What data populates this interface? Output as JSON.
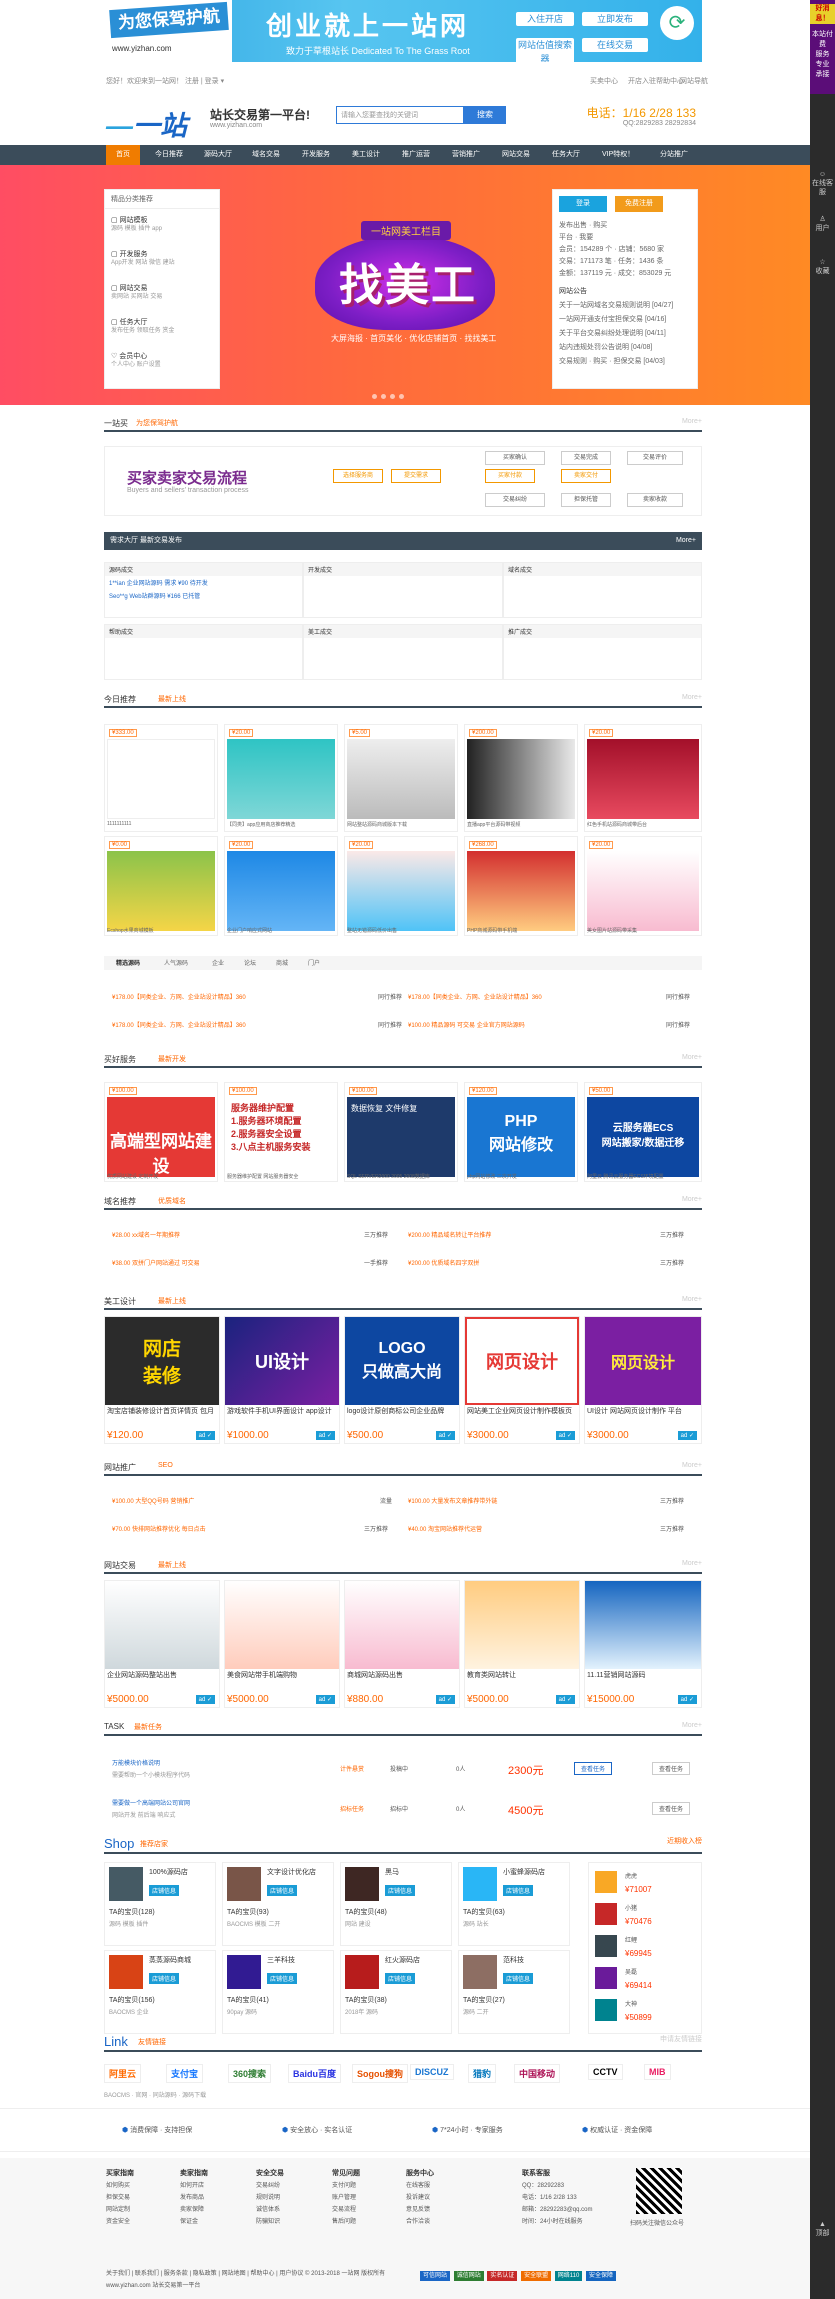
{
  "side": {
    "hot": "好消息！",
    "hot_text": [
      "本站付",
      "费",
      "服务",
      "专业",
      "承接",
      "项目"
    ],
    "icons": [
      "在线客服",
      "用户",
      "收藏",
      "返回",
      "顶部"
    ]
  },
  "banner": {
    "left_title": "为您保驾护航",
    "left_url": "www.yizhan.com",
    "title": "创业就上一站网",
    "sub": "致力于草根站长 Dedicated To The Grass Root",
    "btn_open": "入住开店",
    "btn_hot": "立即发布",
    "btn_trade": "网站估值搜索器",
    "btn_qq": "在线交易"
  },
  "topbar": {
    "left": "您好！欢迎来到一站网！  注册 | 登录  ▾",
    "right": [
      "买卖中心",
      "开店入驻",
      "帮助中心",
      "网站导航"
    ]
  },
  "header": {
    "logo": "一站网",
    "slogan": "站长交易第一平台!",
    "slogan2": "www.yizhan.com",
    "search_placeholder": "请输入您要查找的关键词",
    "search_btn": "搜索",
    "phone": "电话：1/16 2/28 133",
    "qq": "QQ:2829283 28292834"
  },
  "nav": [
    "首页",
    "今日推荐",
    "源码大厅",
    "域名交易",
    "网站交易",
    "开发服务",
    "美工设计",
    "推广运营",
    "营销推广",
    "网站交易",
    "任务大厅",
    "VIP特权！",
    "分站推广"
  ],
  "hero": {
    "cat_title": "精品分类推荐",
    "cats": [
      {
        "t": "网站模板",
        "s": "源码 模板 插件 app"
      },
      {
        "t": "开发服务",
        "s": "App开发 网站 微信 建站"
      },
      {
        "t": "网站交易",
        "s": "卖网站 买网站 交易"
      },
      {
        "t": "任务大厅",
        "s": "发布任务 领取任务 赏金"
      },
      {
        "t": "会员中心",
        "s": "个人中心 账户设置"
      }
    ],
    "tag": "一站网美工栏目",
    "big": "找美工",
    "note": "大屏海报 · 首页美化 · 优化店铺首页 · 找找美工",
    "login": "登录",
    "register": "免费注册",
    "user_lines": [
      "发布出售 · 购买",
      "平台 · 我要",
      "会员：154289 个 · 店铺：5680 家",
      "交易：171173 笔 · 任务：1436 条",
      "金额：137119 元 · 成交：853029 元"
    ],
    "news_title": "网站公告",
    "news": [
      "关于一站网域名交易规则说明 [04/27]",
      "一站网开通支付宝担保交易 [04/16]",
      "关于平台交易纠纷处理说明 [04/11]",
      "站内违规处罚公告说明 [04/08]",
      "交易规则 · 购买 · 担保交易 [04/03]"
    ]
  },
  "s1": {
    "a": "一站买",
    "b": "为您保驾护航",
    "c": "More+",
    "flow_t": "买家卖家交易流程",
    "flow_s": "Buyers and sellers' transaction process",
    "steps": [
      "选择服务商",
      "提交需求",
      "买家付款",
      "买家确认",
      "卖家交付",
      "交易完成",
      "交易纠纷",
      "担保托管",
      "卖家收款",
      "交易评价"
    ]
  },
  "s2": {
    "title": "需求大厅  最新交易发布",
    "more": "More+",
    "cells": [
      "源码成交",
      "开发成交",
      "域名成交",
      "帮助成交",
      "美工成交",
      "推广成交"
    ],
    "lines": [
      "1**ian 企业网站源码 需求 ¥90 待开发",
      "Seo**g Web站群源码 ¥166 已托管"
    ]
  },
  "s3": {
    "a": "今日推荐",
    "b": "最新上线",
    "c": "More+",
    "items": [
      {
        "p": "¥333.00",
        "cap": "1111111111"
      },
      {
        "p": "¥20.00",
        "cap": "【同类】app应用商店推荐精选"
      },
      {
        "p": "¥5.00",
        "cap": "网站整站源码商城版本下载"
      },
      {
        "p": "¥200.00",
        "cap": "直播app平台源码带视频"
      },
      {
        "p": "¥20.00",
        "cap": "红色手机站源码商城带后台"
      },
      {
        "p": "¥0.00",
        "cap": "Ecshop水果商城模板"
      },
      {
        "p": "¥20.00",
        "cap": "企业门户响应式网站"
      },
      {
        "p": "¥20.00",
        "cap": "整站无错源码低价出售"
      },
      {
        "p": "¥268.00",
        "cap": "PHP商城源码带手机端"
      },
      {
        "p": "¥20.00",
        "cap": "美女图片站源码带采集"
      }
    ],
    "tabs": [
      "精选源码",
      "人气源码",
      "企业",
      "论坛",
      "商城",
      "门户"
    ],
    "rows": [
      [
        "¥178.00【同类企业、方网、企业站设计精品】360",
        "同行推荐",
        "¥178.00【同类企业、方网、企业站设计精品】360",
        "同行推荐"
      ],
      [
        "¥178.00【同类企业、方网、企业站设计精品】360",
        "同行推荐",
        "¥100.00 精品源码 可交易 企业官方网站源码",
        "同行推荐"
      ]
    ]
  },
  "s4": {
    "a": "买好服务",
    "b": "最新开发",
    "c": "More+",
    "items": [
      {
        "p": "¥100.00",
        "t": "高端型网站建设",
        "cap": "优质网站建设 定制开发"
      },
      {
        "p": "¥100.00",
        "t": "服务器维护配置\n1.服务器环境配置\n2.服务器安全设置\n3.八点主机服务安装",
        "cap": "服务器维护配置 网站服务器安全"
      },
      {
        "p": "¥100.00",
        "t": "数据恢复 文件修复",
        "cap": "SQL SERVER2000 2005 2008数据库"
      },
      {
        "p": "¥120.00",
        "t": "PHP\n网站修改",
        "cap": "php网站修改 二次开发"
      },
      {
        "p": "¥50.00",
        "t": "云服务器ECS\n网站搬家/数据迁移",
        "cap": "阿里云 腾讯云服务器ECS环境配置"
      }
    ]
  },
  "s5": {
    "a": "域名推荐",
    "b": "优质域名",
    "c": "More+",
    "rows": [
      [
        "¥28.00 xx域名一年期推荐",
        "三万推荐",
        "¥200.00 精品域名转让平台推荐",
        "三万推荐"
      ],
      [
        "¥38.00 双拼门户网站通过 可交易",
        "一手推荐",
        "¥200.00 优质域名四字双拼",
        "三万推荐"
      ]
    ]
  },
  "s6": {
    "a": "美工设计",
    "b": "最新上线",
    "c": "More+",
    "items": [
      {
        "t": "网店\n装修",
        "cap": "淘宝店铺装修设计首页详情页 包月",
        "p": "¥120.00"
      },
      {
        "t": "UI设计",
        "cap": "游戏软件手机UI界面设计 app设计",
        "p": "¥1000.00"
      },
      {
        "t": "LOGO\n只做高大尚",
        "cap": "logo设计原创商标公司企业品牌",
        "p": "¥500.00"
      },
      {
        "t": "网页设计",
        "cap": "网站美工企业网页设计制作模板页",
        "p": "¥3000.00"
      },
      {
        "t": "网页设计",
        "cap": "UI设计 网站网页设计制作 平台",
        "p": "¥3000.00"
      }
    ]
  },
  "s7": {
    "a": "网站推广",
    "b": "SEO",
    "c": "More+",
    "rows": [
      [
        "¥100.00 大型QQ号码 营销推广",
        "流量",
        "¥100.00 大量发布文章推荐带外链",
        "三万推荐"
      ],
      [
        "¥70.00 快排网站推荐优化 每日点击",
        "三万推荐",
        "¥40.00 淘宝网站推荐代运营",
        "三万推荐"
      ]
    ]
  },
  "s8": {
    "a": "网站交易",
    "b": "最新上线",
    "c": "More+",
    "items": [
      {
        "cap": "企业网站源码整站出售",
        "p": "¥5000.00"
      },
      {
        "cap": "美食网站带手机端购物",
        "p": "¥5000.00"
      },
      {
        "cap": "商城网站源码出售",
        "p": "¥880.00"
      },
      {
        "cap": "教育类网站转让",
        "p": "¥5000.00"
      },
      {
        "cap": "11.11营销网站源码",
        "p": "¥15000.00"
      }
    ]
  },
  "s9": {
    "a": "TASK",
    "b": "最新任务",
    "c": "More+",
    "tasks": [
      {
        "t": "万能模块价格说明",
        "d": "需要帮助一个小模块程序代码",
        "k": "计件悬赏",
        "n": "0人",
        "m": "2300元",
        "st": "投稿中",
        "btn": "查看任务"
      },
      {
        "t": "需要做一个高端网站公司官网",
        "d": "网站开发 前后端 响应式",
        "k": "招标任务",
        "n": "0人",
        "m": "4500元",
        "st": "招标中",
        "btn": "查看任务"
      }
    ]
  },
  "s10": {
    "a": "Shop",
    "b": "推荐店家",
    "c": "近期收入榜",
    "shops": [
      {
        "n": "100%源码店",
        "l": "TA的宝贝(128)",
        "l2": "源码 模板 插件"
      },
      {
        "n": "文字设计优化店",
        "l": "TA的宝贝(93)",
        "l2": "BAOCMS 模板 二开"
      },
      {
        "n": "黑马",
        "l": "TA的宝贝(48)",
        "l2": "网站 建设"
      },
      {
        "n": "小蜜蜂源码店",
        "l": "TA的宝贝(63)",
        "l2": "源码 站长"
      },
      {
        "n": "蒸蒸源码商城",
        "l": "TA的宝贝(156)",
        "l2": "BAOCMS 企业"
      },
      {
        "n": "三羊科技",
        "l": "TA的宝贝(41)",
        "l2": "90pay 源码"
      },
      {
        "n": "红火源码店",
        "l": "TA的宝贝(38)",
        "l2": "2018年 源码"
      },
      {
        "n": "范科技",
        "l": "TA的宝贝(27)",
        "l2": "源码 二开"
      }
    ],
    "rank": [
      {
        "n": "虎虎",
        "v": "¥71007"
      },
      {
        "n": "小猪",
        "v": "¥70476"
      },
      {
        "n": "红鲤",
        "v": "¥69945"
      },
      {
        "n": "吴磊",
        "v": "¥69414"
      },
      {
        "n": "大神",
        "v": "¥50899"
      }
    ]
  },
  "s11": {
    "a": "Link",
    "b": "友情链接",
    "c": "申请友情链接",
    "links": [
      "阿里云",
      "支付宝",
      "360搜索",
      "Baidu百度",
      "Sogou搜狗",
      "DISCUZ",
      "猎豹",
      "中国移动",
      "CCTV",
      "MIB"
    ],
    "text": [
      "BAOCMS",
      "官网",
      "同站源码",
      "源码下载",
      "建站",
      "模板"
    ]
  },
  "feat": [
    "消费保障 · 支持担保",
    "安全放心 · 实名认证",
    "7*24小时 · 专家服务",
    "权威认证 · 资金保障"
  ],
  "footer": {
    "cols": [
      {
        "t": "买家指南",
        "i": [
          "如何购买",
          "担保交易",
          "网站定制",
          "资金安全"
        ]
      },
      {
        "t": "卖家指南",
        "i": [
          "如何开店",
          "发布商品",
          "卖家保障",
          "保证金"
        ]
      },
      {
        "t": "安全交易",
        "i": [
          "交易纠纷",
          "规则说明",
          "诚信体系",
          "防骗知识"
        ]
      },
      {
        "t": "常见问题",
        "i": [
          "支付问题",
          "账户管理",
          "交易流程",
          "售后问题"
        ]
      },
      {
        "t": "服务中心",
        "i": [
          "在线客服",
          "投诉建议",
          "意见反馈",
          "合作洽谈"
        ]
      }
    ],
    "service_t": "联系客服",
    "service": [
      "QQ：28292283",
      "电话：1/16 2/28 133",
      "邮箱：28292283@qq.com",
      "时间：24小时在线服务"
    ],
    "qrcap": "扫码关注微信公众号",
    "bottom": "关于我们 | 联系我们 | 服务条款 | 隐私政策 | 网站地图 | 帮助中心 | 用户协议 © 2013-2018 一站网 版权所有",
    "bottom2": "www.yizhan.com 站长交易第一平台",
    "badges": [
      "可信网站",
      "诚信网站",
      "实名认证",
      "安全联盟",
      "网络110",
      "安全保障"
    ]
  }
}
